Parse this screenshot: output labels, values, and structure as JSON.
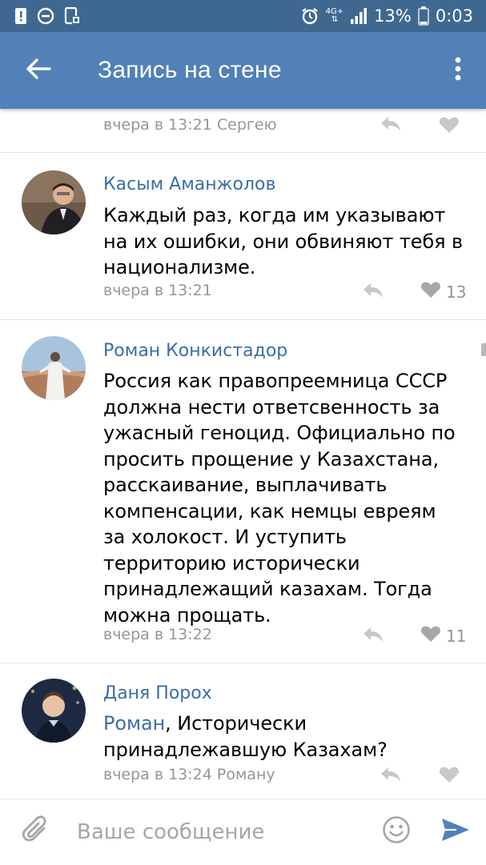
{
  "status_bar": {
    "network": "4G+",
    "battery": "13%",
    "time": "0:03",
    "icons": [
      "alert-icon",
      "do-not-disturb-icon",
      "screenshot-icon",
      "alarm-icon",
      "signal-icon",
      "battery-icon"
    ]
  },
  "app_bar": {
    "title": "Запись на стене",
    "icons": [
      "back-arrow-icon",
      "more-vert-icon"
    ]
  },
  "feed": {
    "top_meta": "вчера в 13:21 Сергею",
    "comments": [
      {
        "author": "Касым Аманжолов",
        "text": "Каждый раз, когда им указывают на их ошибки, они обвиняют тебя в национализме.",
        "meta": "вчера в 13:21",
        "likes": "13"
      },
      {
        "author": "Роман Конкистадор",
        "text": "Россия как правопреемница СССР должна нести ответсвенность за ужасный геноцид. Официально по просить прощение у Казахстана, расскаивание,  выплачивать компенсации, как немцы евреям за холокост. И уступить территорию исторически принадлежащий казахам. Тогда можна прощать.",
        "meta": "вчера в 13:22",
        "likes": "11"
      },
      {
        "author": "Даня Порох",
        "mention": "Роман",
        "text": ", Исторически принадлежавшую Казахам?",
        "meta": "вчера в 13:24 Роману",
        "likes": ""
      }
    ]
  },
  "composer": {
    "placeholder": "Ваше сообщение",
    "icons": [
      "attach-icon",
      "emoji-icon",
      "send-icon"
    ]
  },
  "colors": {
    "status_bar": "#3f6891",
    "app_bar": "#5181b8",
    "author": "#3b6ea5",
    "meta": "#939699",
    "divider": "#e2e4e7"
  }
}
